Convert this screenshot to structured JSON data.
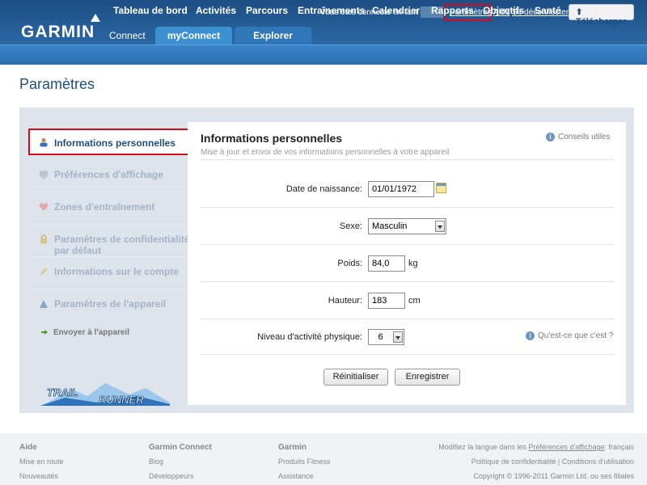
{
  "header": {
    "logo": "GARMIN",
    "logo_sub": "Connect",
    "connected_text": "Vous êtes connecté en tant que",
    "link_params": "Paramètres",
    "link_aide": "Aide",
    "separator": "|",
    "link_logout": "Se déconnecter",
    "download_label": "Télécharger",
    "tabs": [
      "myConnect",
      "Explorer"
    ]
  },
  "nav": [
    "Tableau de bord",
    "Activités",
    "Parcours",
    "Entraînements",
    "Calendrier",
    "Rapports",
    "Objectifs",
    "Santé"
  ],
  "page_title": "Paramètres",
  "sidebar": {
    "active": "Informations personnelles",
    "items": [
      "Préférences d'affichage",
      "Zones d'entraînement",
      "Paramètres de confidentialité par défaut",
      "Informations sur le compte",
      "Paramètres de l'appareil"
    ],
    "send": "Envoyer à l'appareil",
    "logo_text": [
      "TRAIL",
      "RUNNER"
    ]
  },
  "content": {
    "title": "Informations personnelles",
    "subtitle": "Mise à jour et envoi de vos informations personnelles à votre appareil",
    "help": "Conseils utiles",
    "fields": {
      "dob_label": "Date de naissance:",
      "dob_value": "01/01/1972",
      "sex_label": "Sexe:",
      "sex_value": "Masculin",
      "weight_label": "Poids:",
      "weight_value": "84,0",
      "weight_unit": "kg",
      "height_label": "Hauteur:",
      "height_value": "183",
      "height_unit": "cm",
      "activity_label": "Niveau d'activité physique:",
      "activity_value": "6",
      "activity_help": "Qu'est-ce que c'est ?"
    },
    "reset_label": "Réinitialiser",
    "save_label": "Enregistrer"
  },
  "footer": {
    "col1_title": "Aide",
    "col1_links": [
      "Mise en route",
      "Nouveautés"
    ],
    "col2_title": "Garmin Connect",
    "col2_links": [
      "Blog",
      "Développeurs"
    ],
    "col3_title": "Garmin",
    "col3_links": [
      "Produits Fitness",
      "Assistance"
    ],
    "lang_prefix": "Modifiez la langue dans les",
    "lang_link": "Préférences d'affichage",
    "lang_suffix": ": français",
    "privacy": "Politique de confidentialité",
    "terms": "Conditions d'utilisation",
    "copyright": "Copyright © 1996-2011 Garmin Ltd. ou ses filiales"
  },
  "colors": {
    "brand_blue": "#1d4f84",
    "highlight_red": "#d60a18"
  }
}
